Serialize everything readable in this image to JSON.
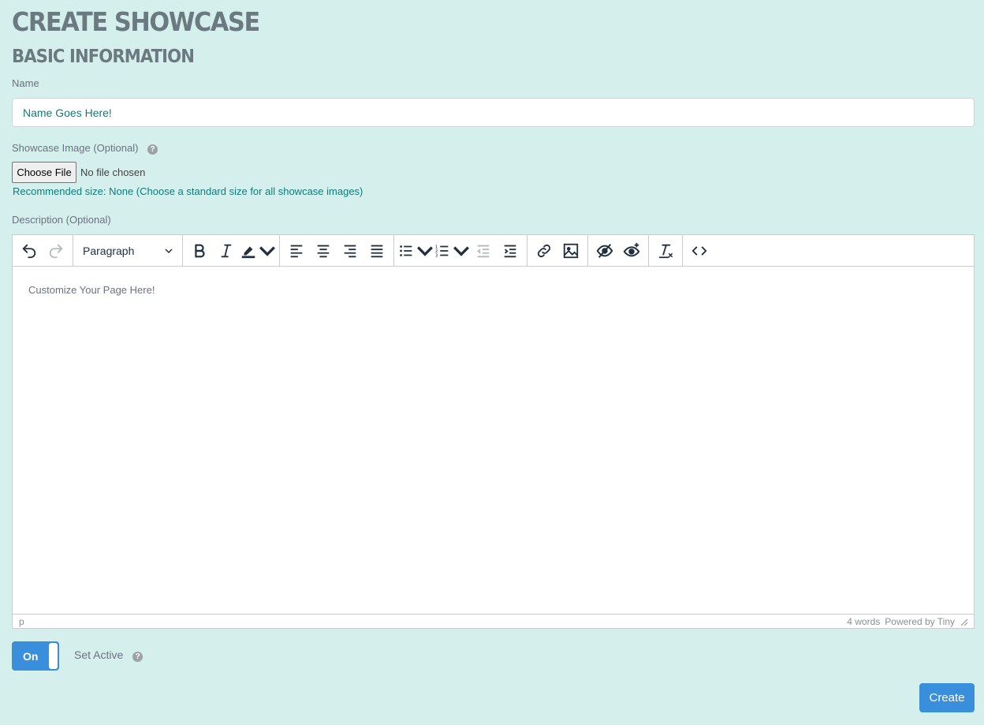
{
  "page": {
    "title": "CREATE SHOWCASE",
    "section": "BASIC INFORMATION"
  },
  "name_field": {
    "label": "Name",
    "value": "Name Goes Here!"
  },
  "image_field": {
    "label": "Showcase Image (Optional)",
    "choose_label": "Choose File",
    "status": "No file chosen",
    "hint": "Recommended size: None (Choose a standard size for all showcase images)"
  },
  "description": {
    "label": "Description (Optional)",
    "format_value": "Paragraph",
    "content": "Customize Your Page Here!",
    "path": "p",
    "word_count": "4 words",
    "powered_by": "Powered by Tiny"
  },
  "toggle": {
    "label": "On",
    "text": "Set Active"
  },
  "actions": {
    "create_label": "Create"
  },
  "icons": {
    "help": "?"
  },
  "colors": {
    "background": "#d4efec",
    "accent": "#3a8fdc",
    "teal_text": "#0e7c7b"
  }
}
